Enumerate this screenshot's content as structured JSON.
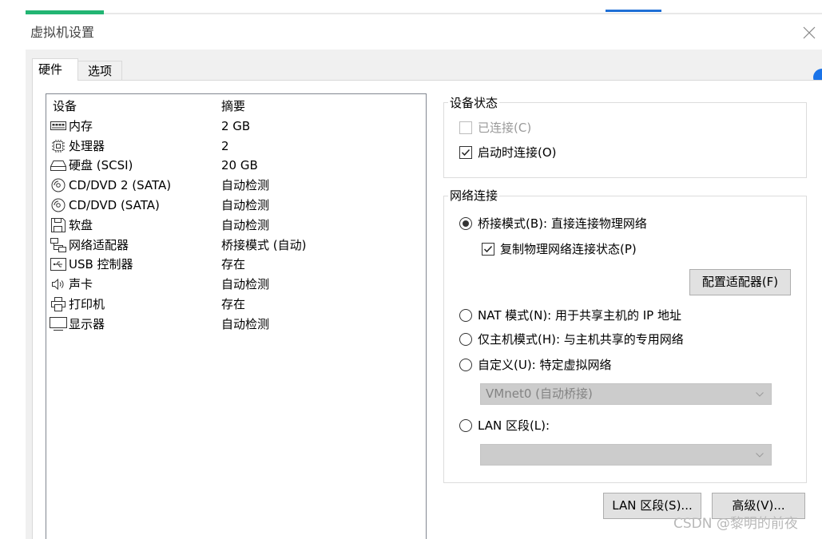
{
  "window": {
    "title": "虚拟机设置"
  },
  "tabs": [
    {
      "label": "硬件",
      "selected": true
    },
    {
      "label": "选项",
      "selected": false
    }
  ],
  "device_list": {
    "columns": [
      "设备",
      "摘要"
    ],
    "rows": [
      {
        "icon": "memory-icon",
        "name": "内存",
        "summary": "2 GB"
      },
      {
        "icon": "processor-icon",
        "name": "处理器",
        "summary": "2"
      },
      {
        "icon": "hard-disk-icon",
        "name": "硬盘 (SCSI)",
        "summary": "20 GB"
      },
      {
        "icon": "cd-dvd-icon",
        "name": "CD/DVD 2 (SATA)",
        "summary": "自动检测"
      },
      {
        "icon": "cd-dvd-icon",
        "name": "CD/DVD (SATA)",
        "summary": "自动检测"
      },
      {
        "icon": "floppy-icon",
        "name": "软盘",
        "summary": "自动检测"
      },
      {
        "icon": "network-adapter-icon",
        "name": "网络适配器",
        "summary": "桥接模式 (自动)"
      },
      {
        "icon": "usb-icon",
        "name": "USB 控制器",
        "summary": "存在"
      },
      {
        "icon": "sound-card-icon",
        "name": "声卡",
        "summary": "自动检测"
      },
      {
        "icon": "printer-icon",
        "name": "打印机",
        "summary": "存在"
      },
      {
        "icon": "display-icon",
        "name": "显示器",
        "summary": "自动检测"
      }
    ]
  },
  "device_status": {
    "title": "设备状态",
    "connected": {
      "label": "已连接(C)",
      "checked": false,
      "disabled": true
    },
    "connect_at_power_on": {
      "label": "启动时连接(O)",
      "checked": true,
      "disabled": false
    }
  },
  "network_connection": {
    "title": "网络连接",
    "bridged": {
      "label": "桥接模式(B): 直接连接物理网络",
      "selected": true
    },
    "replicate_state": {
      "label": "复制物理网络连接状态(P)",
      "checked": true
    },
    "configure_adapters_button": "配置适配器(F)",
    "nat": {
      "label": "NAT 模式(N): 用于共享主机的 IP 地址",
      "selected": false
    },
    "host_only": {
      "label": "仅主机模式(H): 与主机共享的专用网络",
      "selected": false
    },
    "custom": {
      "label": "自定义(U): 特定虚拟网络",
      "selected": false
    },
    "custom_network_select": {
      "value": "VMnet0 (自动桥接)",
      "disabled": true
    },
    "lan_segment": {
      "label": "LAN 区段(L):",
      "selected": false
    },
    "lan_segment_select": {
      "value": "",
      "disabled": true
    }
  },
  "footer_buttons": {
    "lan_segments": "LAN 区段(S)...",
    "advanced": "高级(V)..."
  },
  "watermark": "CSDN @黎明的前夜",
  "colors": {
    "top_progress": "#22b573",
    "top_indicator": "#1f6fd6",
    "corner_badge": "#1a73e8",
    "dialog_background": "#f0f0f0",
    "disabled_select": "#cccccc"
  }
}
